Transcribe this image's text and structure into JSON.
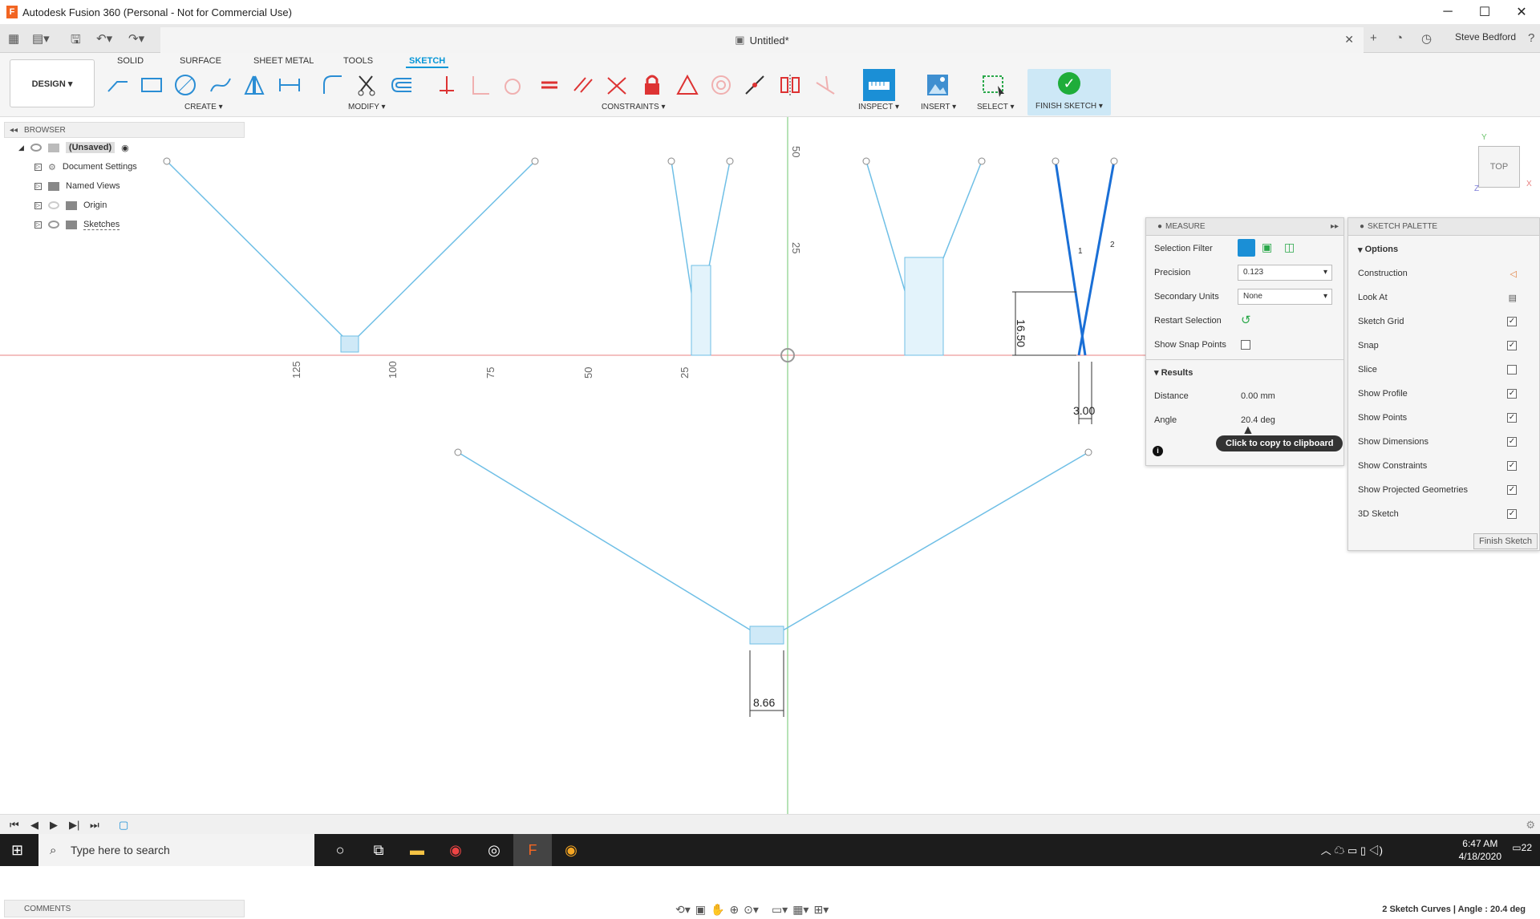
{
  "window": {
    "title": "Autodesk Fusion 360 (Personal - Not for Commercial Use)",
    "logo": "F",
    "minimize": "─",
    "maximize": "☐",
    "close": "✕"
  },
  "header": {
    "doc_title": "Untitled*",
    "user": "Steve Bedford"
  },
  "workspace_tabs": [
    "SOLID",
    "SURFACE",
    "SHEET METAL",
    "TOOLS",
    "SKETCH"
  ],
  "active_tab": "SKETCH",
  "toolbar": {
    "design": "DESIGN ▾",
    "groups": {
      "create": "CREATE ▾",
      "modify": "MODIFY ▾",
      "constraints": "CONSTRAINTS ▾",
      "inspect": "INSPECT ▾",
      "insert": "INSERT ▾",
      "select": "SELECT ▾"
    },
    "finish_sketch": "FINISH SKETCH ▾"
  },
  "browser": {
    "title": "BROWSER",
    "items": [
      "(Unsaved)",
      "Document Settings",
      "Named Views",
      "Origin",
      "Sketches"
    ]
  },
  "canvas": {
    "axis_labels_x": [
      "125",
      "100",
      "75",
      "50",
      "25"
    ],
    "axis_labels_y": [
      "50",
      "25"
    ],
    "dimensions": [
      "16.50",
      "3.00",
      "8.66"
    ],
    "selection_markers": [
      "1",
      "2"
    ]
  },
  "measure": {
    "title": "MEASURE",
    "selection_filter": "Selection Filter",
    "precision_label": "Precision",
    "precision_value": "0.123",
    "secondary_units_label": "Secondary Units",
    "secondary_units_value": "None",
    "restart_selection": "Restart Selection",
    "show_snap_points": "Show Snap Points",
    "results_label": "Results",
    "distance_label": "Distance",
    "distance_value": "0.00 mm",
    "angle_label": "Angle",
    "angle_value": "20.4 deg"
  },
  "tooltip": "Click to copy to clipboard",
  "sketch_palette": {
    "title": "SKETCH PALETTE",
    "options_label": "Options",
    "rows": [
      {
        "label": "Construction",
        "state": "icon"
      },
      {
        "label": "Look At",
        "state": "icon"
      },
      {
        "label": "Sketch Grid",
        "state": "on"
      },
      {
        "label": "Snap",
        "state": "on"
      },
      {
        "label": "Slice",
        "state": "off"
      },
      {
        "label": "Show Profile",
        "state": "on"
      },
      {
        "label": "Show Points",
        "state": "on"
      },
      {
        "label": "Show Dimensions",
        "state": "on"
      },
      {
        "label": "Show Constraints",
        "state": "on"
      },
      {
        "label": "Show Projected Geometries",
        "state": "on"
      },
      {
        "label": "3D Sketch",
        "state": "on"
      }
    ],
    "finish_button": "Finish Sketch"
  },
  "viewcube": {
    "face": "TOP",
    "x": "X",
    "y": "Y",
    "z": "Z"
  },
  "comments": "COMMENTS",
  "status": "2 Sketch Curves | Angle : 20.4 deg",
  "taskbar": {
    "search_placeholder": "Type here to search",
    "time": "6:47 AM",
    "date": "4/18/2020",
    "notifications": "22"
  },
  "colors": {
    "accent": "#0696d7",
    "sketch_line": "#6fbfe6",
    "selected_line": "#1a6fd6",
    "x_axis": "#e88080",
    "y_axis": "#6cc46c",
    "finish_green": "#1fad3a"
  }
}
